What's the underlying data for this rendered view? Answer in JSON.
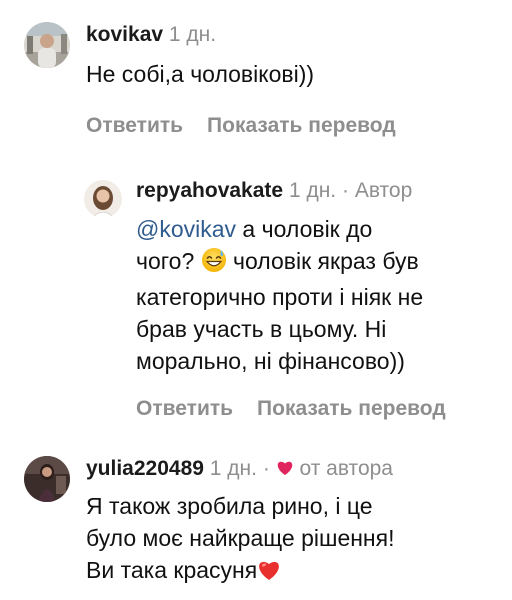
{
  "comments": [
    {
      "username": "kovikav",
      "time": "1 дн.",
      "text": "Не собі,а чоловікові))",
      "reply_label": "Ответить",
      "translate_label": "Показать перевод"
    },
    {
      "username": "repyahovakate",
      "time": "1 дн.",
      "separator": "·",
      "author_label": "Автор",
      "mention": "@kovikav",
      "text_line1_rest": " а чоловік до",
      "text_line2_before_emoji": "чого? ",
      "emoji_icon": "sweat-smile-emoji",
      "text_line2_after_emoji": " чоловік якраз був",
      "text_line3": "категорично проти і ніяк не",
      "text_line4": "брав участь в цьому. Ні",
      "text_line5": "морально, ні фінансово))",
      "reply_label": "Ответить",
      "translate_label": "Показать перевод"
    },
    {
      "username": "yulia220489",
      "time": "1 дн.",
      "separator": "·",
      "heart_icon": "heart-icon",
      "liked_label": "от автора",
      "text_line1": "Я також зробила рино, і це",
      "text_line2": "було моє найкраще рішення!",
      "text_line3": "Ви така красуня"
    }
  ],
  "colors": {
    "meta": "#8e8e8e",
    "mention": "#2f5b8f",
    "heart": "#e0245e"
  }
}
